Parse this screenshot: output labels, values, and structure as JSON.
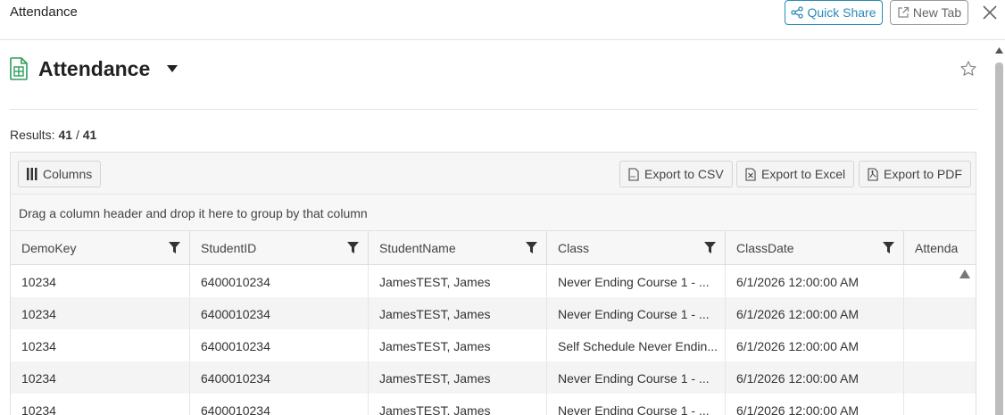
{
  "topbar": {
    "title": "Attendance",
    "quick_share_label": "Quick Share",
    "new_tab_label": "New Tab"
  },
  "page": {
    "title": "Attendance"
  },
  "results": {
    "label": "Results:",
    "shown": "41",
    "separator": "/",
    "total": "41"
  },
  "toolbar": {
    "columns_label": "Columns",
    "export_csv_label": "Export to CSV",
    "export_excel_label": "Export to Excel",
    "export_pdf_label": "Export to PDF"
  },
  "group_panel": {
    "text": "Drag a column header and drop it here to group by that column"
  },
  "table": {
    "headers": [
      "DemoKey",
      "StudentID",
      "StudentName",
      "Class",
      "ClassDate",
      "Attenda"
    ],
    "rows": [
      [
        "10234",
        "6400010234",
        "JamesTEST, James",
        "Never Ending Course 1 - ...",
        "6/1/2026 12:00:00 AM",
        ""
      ],
      [
        "10234",
        "6400010234",
        "JamesTEST, James",
        "Never Ending Course 1 - ...",
        "6/1/2026 12:00:00 AM",
        ""
      ],
      [
        "10234",
        "6400010234",
        "JamesTEST, James",
        "Self Schedule Never Endin...",
        "6/1/2026 12:00:00 AM",
        ""
      ],
      [
        "10234",
        "6400010234",
        "JamesTEST, James",
        "Never Ending Course 1 - ...",
        "6/1/2026 12:00:00 AM",
        ""
      ],
      [
        "10234",
        "6400010234",
        "JamesTEST, James",
        "Never Ending Course 1 - ...",
        "6/1/2026 12:00:00 AM",
        ""
      ]
    ]
  },
  "colors": {
    "accent": "#2a8ab8",
    "sheet_icon": "#2e9e5b"
  },
  "icons": {
    "share": "share-icon",
    "new_tab": "external-link-icon",
    "close": "close-icon",
    "sheet": "spreadsheet-icon",
    "caret": "caret-down-icon",
    "star": "star-icon",
    "columns": "columns-icon",
    "csv": "csv-file-icon",
    "excel": "excel-file-icon",
    "pdf": "pdf-file-icon",
    "filter": "filter-icon"
  }
}
